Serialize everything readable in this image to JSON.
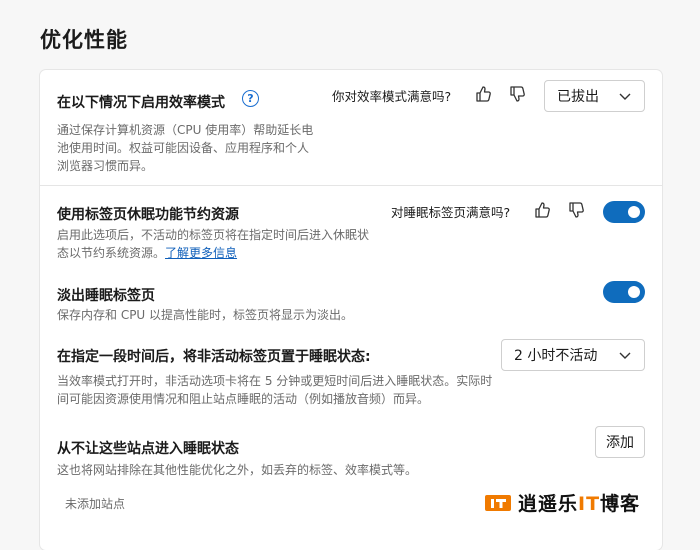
{
  "page": {
    "title": "优化性能"
  },
  "efficiency": {
    "heading": "在以下情况下启用效率模式",
    "help_glyph": "?",
    "description": "通过保存计算机资源（CPU 使用率）帮助延长电池使用时间。权益可能因设备、应用程序和个人浏览器习惯而异。",
    "feedback_question": "你对效率模式满意吗?",
    "dropdown_value": "已拔出"
  },
  "sleeping_tabs": {
    "heading": "使用标签页休眠功能节约资源",
    "description": "启用此选项后，不活动的标签页将在指定时间后进入休眠状态以节约系统资源。",
    "learn_more": "了解更多信息",
    "feedback_question": "对睡眠标签页满意吗?",
    "toggle_on": true
  },
  "fade_tabs": {
    "heading": "淡出睡眠标签页",
    "description": "保存内存和 CPU 以提高性能时，标签页将显示为淡出。",
    "toggle_on": true
  },
  "sleep_after": {
    "heading": "在指定一段时间后，将非活动标签页置于睡眠状态:",
    "description": "当效率模式打开时，非活动选项卡将在 5 分钟或更短时间后进入睡眠状态。实际时间可能因资源使用情况和阻止站点睡眠的活动（例如播放音频）而异。",
    "dropdown_value": "2 小时不活动"
  },
  "never_sleep": {
    "heading": "从不让这些站点进入睡眠状态",
    "description": "这也将网站排除在其他性能优化之外，如丢弃的标签、效率模式等。",
    "add_label": "添加",
    "empty_text": "未添加站点"
  },
  "watermark": {
    "text_a": "逍遥乐",
    "text_it": "IT",
    "text_b": "博客"
  },
  "colors": {
    "accent": "#0f6cbd",
    "link": "#0f5fba",
    "muted": "#6b6b6b"
  }
}
